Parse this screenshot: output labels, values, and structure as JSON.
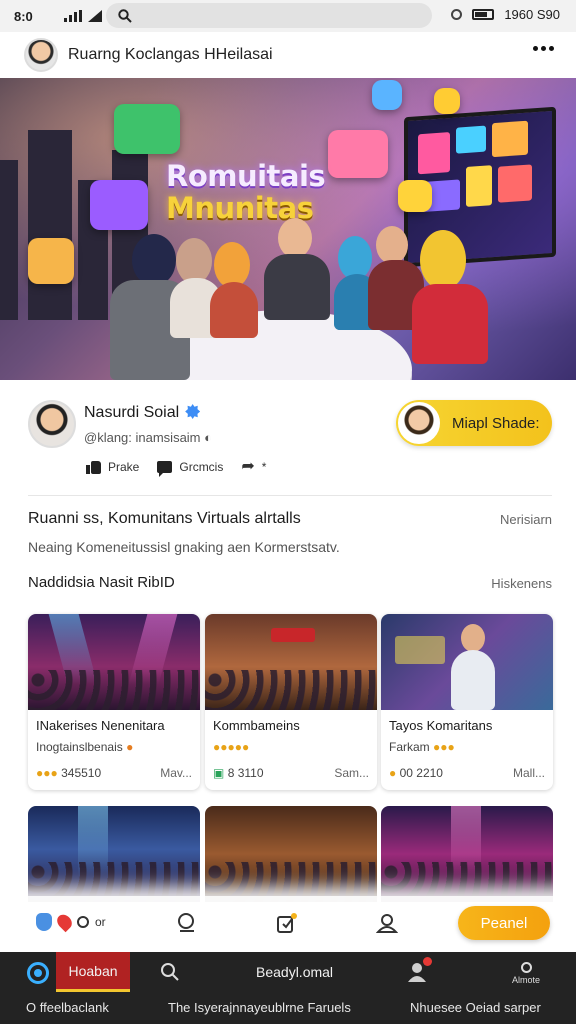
{
  "status_bar": {
    "time": "8:0",
    "right_text": "1960 S90"
  },
  "header": {
    "title": "Ruarng Koclangas HHeilasai"
  },
  "hero": {
    "title_line1": "Romuitais",
    "title_line2": "Mnunitas"
  },
  "profile": {
    "name": "Nasurdi Soial",
    "handle": "@klang: inamsisaim",
    "actions": [
      {
        "label": "Prake"
      },
      {
        "label": "Grcmcis"
      },
      {
        "label": "*"
      }
    ],
    "pill_label": "Miapl Shade:"
  },
  "info": {
    "title": "Ruanni ss, Komunitans Virtuals alrtalls",
    "right": "Nerisiarn",
    "subtitle": "Neaing Komeneitussisl gnaking aen Kormerstsatv."
  },
  "section": {
    "title": "Naddidsia Nasit RibID",
    "right": "Hiskenens"
  },
  "cards": [
    {
      "title": "INakerises Nenenitara",
      "subtitle": "Inogtainslbenais",
      "stat": "345510",
      "more": "Mav..."
    },
    {
      "title": "Kommbameins",
      "subtitle": "",
      "stat": "8 3110",
      "more": "Sam..."
    },
    {
      "title": "Tayos Komaritans",
      "subtitle": "Farkam",
      "stat": "00 2210",
      "more": "Mall..."
    }
  ],
  "action_bar": {
    "small_text": "or",
    "primary_button": "Peanel"
  },
  "nav": {
    "active_tab": "Hoaban",
    "center": "Beadyl.omal",
    "more": "Almote",
    "bottom_left": "O ffeelbaclank",
    "bottom_center": "The Isyerajnnayeublrne Faruels",
    "bottom_right": "Nhuesee Oeiad sarper"
  },
  "colors": {
    "accent_yellow": "#f4c21c",
    "nav_active": "#b02222",
    "verified": "#3d8df5",
    "primary_button": "#f4a10e"
  }
}
